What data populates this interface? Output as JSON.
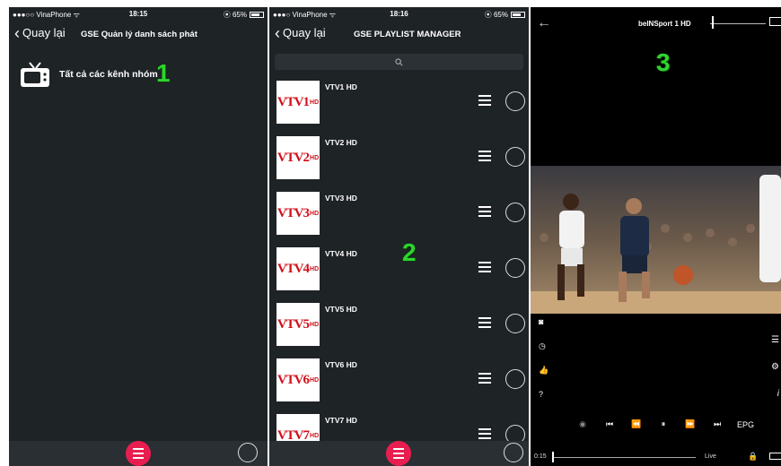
{
  "panel1": {
    "status": {
      "carrier": "●●●○○ VinaPhone ᯤ",
      "time": "18:15",
      "battery": "⦿ 65%"
    },
    "back_label": "Quay lại",
    "title": "GSE Quản lý danh sách phát",
    "group_label": "Tất cả các kênh nhóm",
    "badge": "1"
  },
  "panel2": {
    "status": {
      "carrier": "●●●○ VinaPhone ᯤ",
      "time": "18:16",
      "battery": "⦿ 65%"
    },
    "back_label": "Quay lại",
    "title": "GSE PLAYLIST MANAGER",
    "badge": "2",
    "channels": [
      {
        "name": "VTV1 HD",
        "logo_num": "1"
      },
      {
        "name": "VTV2 HD",
        "logo_num": "2"
      },
      {
        "name": "VTV3 HD",
        "logo_num": "3"
      },
      {
        "name": "VTV4 HD",
        "logo_num": "4"
      },
      {
        "name": "VTV5 HD",
        "logo_num": "5"
      },
      {
        "name": "VTV6 HD",
        "logo_num": "6"
      },
      {
        "name": "VTV7 HD",
        "logo_num": "7"
      }
    ]
  },
  "panel3": {
    "channel_title": "beINSport 1 HD",
    "badge": "3",
    "time_elapsed": "0:15",
    "live_label": "Live",
    "epg_label": "EPG"
  },
  "colors": {
    "accent": "#e91e50",
    "panel_bg": "#1e2326",
    "badge_green": "#2fd52f",
    "logo_red": "#d10f1a"
  }
}
